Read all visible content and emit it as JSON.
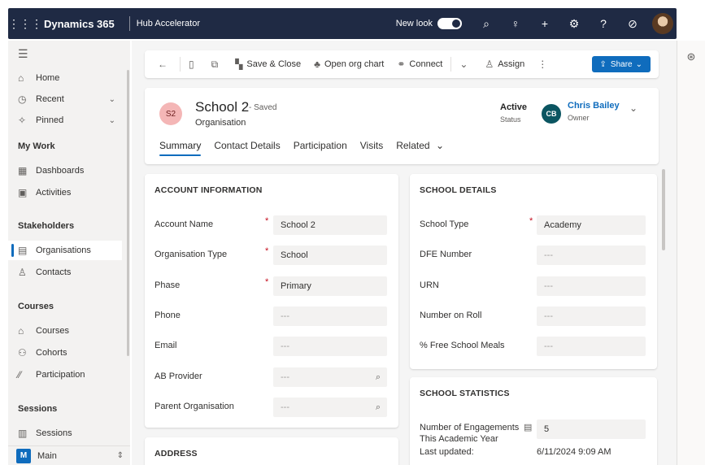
{
  "topbar": {
    "app_title": "Dynamics 365",
    "app_name": "Hub Accelerator",
    "new_look_label": "New look",
    "icons": [
      "waffle-icon",
      "search-icon",
      "lightbulb-icon",
      "plus-icon",
      "gear-icon",
      "help-icon",
      "copilot-icon",
      "user-avatar"
    ]
  },
  "sidebar": {
    "items_top": [
      {
        "label": "Home",
        "icon": "home-icon"
      },
      {
        "label": "Recent",
        "icon": "clock-icon"
      },
      {
        "label": "Pinned",
        "icon": "pin-icon"
      }
    ],
    "sections": [
      {
        "header": "My Work",
        "items": [
          {
            "label": "Dashboards"
          },
          {
            "label": "Activities"
          }
        ]
      },
      {
        "header": "Stakeholders",
        "items": [
          {
            "label": "Organisations"
          },
          {
            "label": "Contacts"
          }
        ]
      },
      {
        "header": "Courses",
        "items": [
          {
            "label": "Courses"
          },
          {
            "label": "Cohorts"
          },
          {
            "label": "Participation"
          }
        ]
      },
      {
        "header": "Sessions",
        "items": [
          {
            "label": "Sessions"
          }
        ]
      }
    ],
    "area": {
      "badge": "M",
      "label": "Main"
    }
  },
  "commandbar": {
    "save_close": "Save & Close",
    "open_org_chart": "Open org chart",
    "connect": "Connect",
    "assign": "Assign",
    "share": "Share"
  },
  "record": {
    "initials": "S2",
    "title": "School 2",
    "saved": "- Saved",
    "entity": "Organisation",
    "status_value": "Active",
    "status_label": "Status",
    "owner_initials": "CB",
    "owner_name": "Chris Bailey",
    "owner_label": "Owner"
  },
  "tabs": [
    "Summary",
    "Contact Details",
    "Participation",
    "Visits",
    "Related"
  ],
  "account_info": {
    "title": "ACCOUNT INFORMATION",
    "fields": [
      {
        "label": "Account Name",
        "value": "School 2"
      },
      {
        "label": "Organisation Type",
        "value": "School"
      },
      {
        "label": "Phase",
        "value": "Primary"
      },
      {
        "label": "Phone",
        "value": "---"
      },
      {
        "label": "Email",
        "value": "---"
      },
      {
        "label": "AB Provider",
        "value": "---"
      },
      {
        "label": "Parent Organisation",
        "value": "---"
      }
    ]
  },
  "school_details": {
    "title": "SCHOOL DETAILS",
    "fields": [
      {
        "label": "School Type",
        "value": "Academy"
      },
      {
        "label": "DFE Number",
        "value": "---"
      },
      {
        "label": "URN",
        "value": "---"
      },
      {
        "label": "Number on Roll",
        "value": "---"
      },
      {
        "label": "% Free School Meals",
        "value": "---"
      }
    ]
  },
  "school_stats": {
    "title": "SCHOOL STATISTICS",
    "engagements_label_1": "Number of Engagements",
    "engagements_label_2": "This Academic Year",
    "engagements_value": "5",
    "last_updated_label": "Last updated:",
    "last_updated_value": "6/11/2024 9:09 AM"
  },
  "address": {
    "title": "ADDRESS"
  }
}
